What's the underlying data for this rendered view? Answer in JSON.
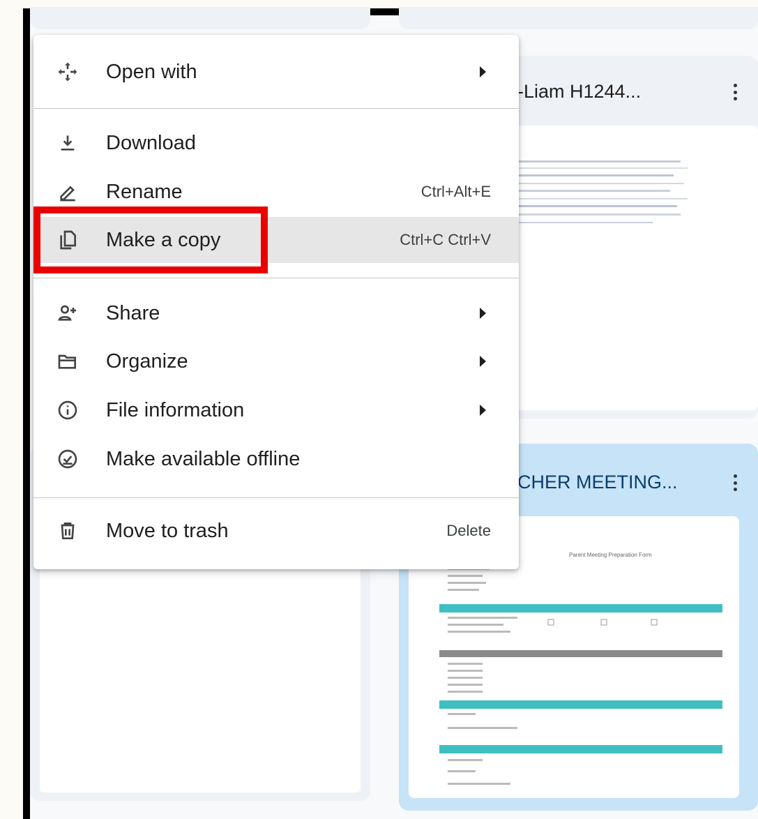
{
  "cards": [
    {
      "title": "-Liam H1244...",
      "selected": false
    },
    {
      "title": "CHER MEETING...",
      "selected": true
    }
  ],
  "preview_doc": {
    "heading": "Parent Meeting Preparation Form",
    "accent_color": "#3fbfc1"
  },
  "context_menu": {
    "items": [
      {
        "label": "Open with",
        "icon": "open-with-icon",
        "shortcut": "",
        "submenu": true
      },
      {
        "label": "Download",
        "icon": "download-icon",
        "shortcut": "",
        "submenu": false
      },
      {
        "label": "Rename",
        "icon": "rename-pencil-icon",
        "shortcut": "Ctrl+Alt+E",
        "submenu": false
      },
      {
        "label": "Make a copy",
        "icon": "copy-icon",
        "shortcut": "Ctrl+C Ctrl+V",
        "submenu": false,
        "active": true
      },
      {
        "label": "Share",
        "icon": "share-person-add-icon",
        "shortcut": "",
        "submenu": true
      },
      {
        "label": "Organize",
        "icon": "folder-open-icon",
        "shortcut": "",
        "submenu": true
      },
      {
        "label": "File information",
        "icon": "info-icon",
        "shortcut": "",
        "submenu": true
      },
      {
        "label": "Make available offline",
        "icon": "offline-check-icon",
        "shortcut": "",
        "submenu": false
      },
      {
        "label": "Move to trash",
        "icon": "trash-icon",
        "shortcut": "Delete",
        "submenu": false
      }
    ]
  },
  "colors": {
    "highlight_box": "#ea0000",
    "selected_card": "#c7e3f7",
    "menu_active": "#e6e6e6"
  }
}
